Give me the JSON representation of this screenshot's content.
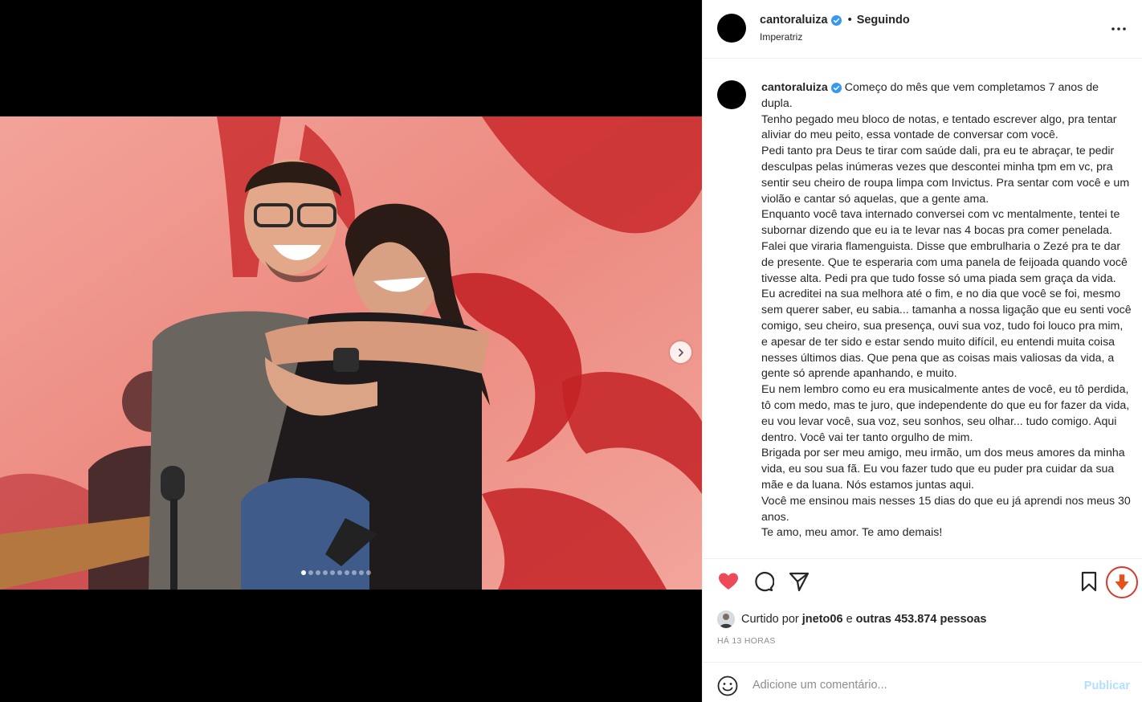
{
  "post": {
    "username": "cantoraluiza",
    "follow_state": "Seguindo",
    "separator": "•",
    "location": "Imperatriz",
    "media": {
      "slide_count": 10,
      "active_slide": 1
    },
    "caption": {
      "username": "cantoraluiza",
      "lines": [
        "Começo do mês que vem completamos 7 anos de dupla.",
        "Tenho pegado meu bloco de notas, e tentado escrever algo, pra tentar aliviar do meu peito, essa vontade de conversar com você.",
        "Pedi tanto pra Deus te tirar com saúde dali, pra eu te abraçar, te pedir desculpas pelas inúmeras vezes que descontei minha tpm em vc, pra sentir seu cheiro de roupa limpa com Invictus. Pra sentar com você e um violão e cantar só aquelas, que a gente ama.",
        "Enquanto você tava internado conversei com vc mentalmente, tentei te subornar dizendo que eu ia te levar nas 4 bocas pra comer penelada. Falei que viraria flamenguista. Disse que embrulharia o Zezé pra te dar de presente. Que te esperaria com uma panela de feijoada quando você tivesse alta. Pedi pra que tudo fosse só uma piada sem graça da vida.",
        "Eu acreditei na sua melhora até o fim, e no dia que você se foi, mesmo sem querer saber, eu sabia... tamanha a nossa ligação que eu senti você comigo, seu cheiro, sua presença, ouvi sua voz, tudo foi louco pra mim, e apesar de ter sido e estar sendo muito difícil, eu entendi muita coisa nesses últimos dias. Que pena que as coisas mais valiosas da vida, a gente só aprende apanhando, e muito.",
        "Eu nem lembro como eu era musicalmente antes de você, eu tô perdida, tô com medo, mas te juro, que independente do que eu for fazer da vida, eu vou levar você, sua voz, seu sonhos, seu olhar... tudo comigo. Aqui dentro. Você vai ter tanto orgulho de mim.",
        "Brigada por ser meu amigo, meu irmão, um dos meus amores da minha vida, eu sou sua fã. Eu vou fazer tudo que eu puder pra cuidar da sua mãe e da luana. Nós estamos juntas aqui.",
        "Você me ensinou mais nesses 15 dias do que eu já aprendi nos meus 30 anos.",
        "Te amo, meu amor. Te amo demais!"
      ]
    },
    "likes": {
      "prefix": "Curtido por",
      "user": "jneto06",
      "connector": "e",
      "others": "outras 453.874 pessoas"
    },
    "timestamp": "HÁ 13 HORAS",
    "comment": {
      "placeholder": "Adicione um comentário...",
      "publish_label": "Publicar"
    }
  },
  "icons": {
    "like": "heart-filled-icon",
    "comment": "comment-icon",
    "share": "paper-plane-icon",
    "save": "bookmark-icon",
    "download": "download-arrow-icon",
    "more": "more-horizontal-icon",
    "emoji": "emoji-icon",
    "next": "chevron-right-icon",
    "verified": "verified-badge-icon"
  },
  "colors": {
    "like_red": "#ed4956",
    "verified_blue": "#3897f0",
    "publish_disabled": "#b2dffc",
    "download_orange": "#d63a2d",
    "backdrop_red": "#e8796f"
  }
}
